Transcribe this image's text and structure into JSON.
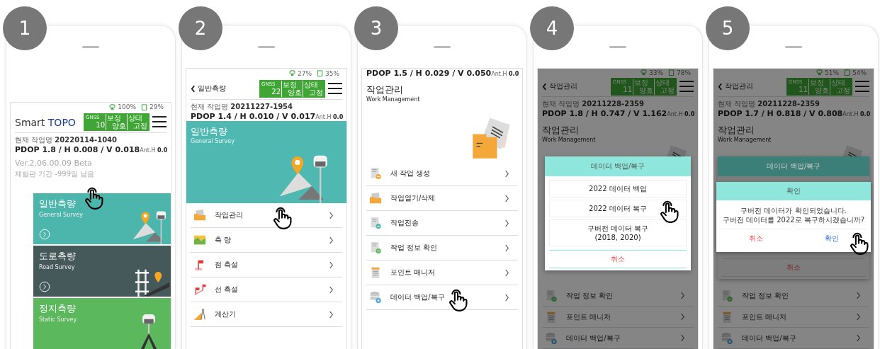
{
  "steps": [
    {
      "number": "1",
      "kind": "home",
      "status": {
        "signal": "100%",
        "battery": "29%"
      },
      "header": {
        "brand": "Smart",
        "brand_accent": "TOPO",
        "gnss": [
          {
            "label": "GNSS",
            "value": "10"
          },
          {
            "label": "보정",
            "value": "양호"
          },
          {
            "label": "상태",
            "value": "고정"
          }
        ]
      },
      "job": "현재 작업명 **20220114-1040**",
      "precision": {
        "pdop": "PDOP 1.8 / H 0.008 / V 0.018",
        "antenna": "Ant.H **0.0**"
      },
      "version": "Ver.2.06.00.09  Beta",
      "trial": "체험판 기간 -999일 남음",
      "cards": [
        {
          "title": "일반측량",
          "subtitle": "General Survey",
          "kind": "general",
          "color": "#4db6ac",
          "arrow": true,
          "tapped": true
        },
        {
          "title": "도로측량",
          "subtitle": "Road Survey",
          "kind": "road",
          "color": "#45585a",
          "arrow": true,
          "tapped": false
        },
        {
          "title": "정지측량",
          "subtitle": "Static Survey",
          "kind": "static",
          "color": "#5cb85c",
          "arrow": false,
          "tapped": false
        }
      ]
    },
    {
      "number": "2",
      "kind": "menu",
      "status": {
        "signal": "27%",
        "battery": "35%"
      },
      "header": {
        "title": "일반측량",
        "gnss": [
          {
            "label": "GNSS",
            "value": "22"
          },
          {
            "label": "보정",
            "value": "양호"
          },
          {
            "label": "상태",
            "value": "고정"
          }
        ]
      },
      "job": "현재 작업명 **20211227-1954**",
      "precision": {
        "pdop": "PDOP 1.4 / H 0.010 / V 0.017",
        "antenna": "Ant.H **0.0**"
      },
      "banner": {
        "title": "일반측량",
        "subtitle": "General Survey"
      },
      "items": [
        {
          "label": "작업관리",
          "kind": "folder",
          "tapped": true
        },
        {
          "label": "측 량",
          "kind": "map",
          "tapped": false
        },
        {
          "label": "점 측설",
          "kind": "flag",
          "tapped": false
        },
        {
          "label": "선 측설",
          "kind": "flags",
          "tapped": false
        },
        {
          "label": "계산기",
          "kind": "ruler",
          "tapped": false
        }
      ]
    },
    {
      "number": "3",
      "kind": "work",
      "precision": {
        "pdop": "PDOP 1.5 / H 0.029 / V 0.050",
        "antenna": "Ant.H **0.0**"
      },
      "section": {
        "title": "작업관리",
        "subtitle": "Work Management"
      },
      "items": [
        {
          "label": "새 작업 생성",
          "kind": "doc-add",
          "tapped": false
        },
        {
          "label": "작업열기/삭제",
          "kind": "doc-open",
          "tapped": false
        },
        {
          "label": "작업전송",
          "kind": "doc-transfer",
          "tapped": false
        },
        {
          "label": "작업 정보 확인",
          "kind": "doc-info",
          "tapped": false
        },
        {
          "label": "포인트 매니저",
          "kind": "list",
          "tapped": false
        },
        {
          "label": "데이터 백업/복구",
          "kind": "database",
          "tapped": true
        }
      ]
    },
    {
      "number": "4",
      "kind": "work",
      "dimmed": true,
      "status": {
        "signal": "33%",
        "battery": "78%"
      },
      "header": {
        "title": "작업관리",
        "gnss": [
          {
            "label": "GNSS",
            "value": "11"
          },
          {
            "label": "보정",
            "value": "양호"
          },
          {
            "label": "상태",
            "value": "고정"
          }
        ]
      },
      "job": "현재 작업명 **20211228-2359**",
      "precision": {
        "pdop": "PDOP 1.8 / H 0.747 / V 1.162",
        "antenna": "Ant.H **0.0**"
      },
      "section": {
        "title": "작업관리",
        "subtitle": "Work Management"
      },
      "items": [
        {
          "label": "작업 정보 확인",
          "kind": "doc-info",
          "tapped": false
        },
        {
          "label": "포인트 매니저",
          "kind": "list",
          "tapped": false
        },
        {
          "label": "데이터 백업/복구",
          "kind": "database",
          "tapped": false
        }
      ],
      "dialog": {
        "title": "데이터 백업/복구",
        "options": [
          {
            "label": "2022 데이터 백업",
            "tapped": false
          },
          {
            "label": "2022 데이터 복구",
            "tapped": true
          },
          {
            "label": "구버전 데이터 복구\n(2018, 2020)",
            "tapped": false
          }
        ],
        "cancel": "취소"
      }
    },
    {
      "number": "5",
      "kind": "work",
      "dimmed": true,
      "status": {
        "signal": "51%",
        "battery": "54%"
      },
      "header": {
        "title": "작업관리",
        "gnss": [
          {
            "label": "GNSS",
            "value": "11"
          },
          {
            "label": "보정",
            "value": "양호"
          },
          {
            "label": "상태",
            "value": "고정"
          }
        ]
      },
      "job": "현재 작업명 **20211228-2359**",
      "precision": {
        "pdop": "PDOP 1.7 / H 0.818 / V 0.808",
        "antenna": "Ant.H **0.0**"
      },
      "section": {
        "title": "작업관리",
        "subtitle": "Work Management"
      },
      "items": [
        {
          "label": "작업 정보 확인",
          "kind": "doc-info",
          "tapped": false
        },
        {
          "label": "포인트 매니저",
          "kind": "list",
          "tapped": false
        },
        {
          "label": "데이터 백업/복구",
          "kind": "database",
          "tapped": false
        }
      ],
      "dialog": {
        "title": "데이터 백업/복구",
        "cancel": "취소",
        "confirm": {
          "title": "확인",
          "message": [
            "구버전 데이터가 확인되었습니다.",
            "구버전 데이터를 2022로 복구하시겠습니까?"
          ],
          "buttons": [
            {
              "label": "취소",
              "kind": "cancel",
              "tapped": false
            },
            {
              "label": "확인",
              "kind": "ok",
              "tapped": true
            }
          ]
        }
      }
    }
  ]
}
